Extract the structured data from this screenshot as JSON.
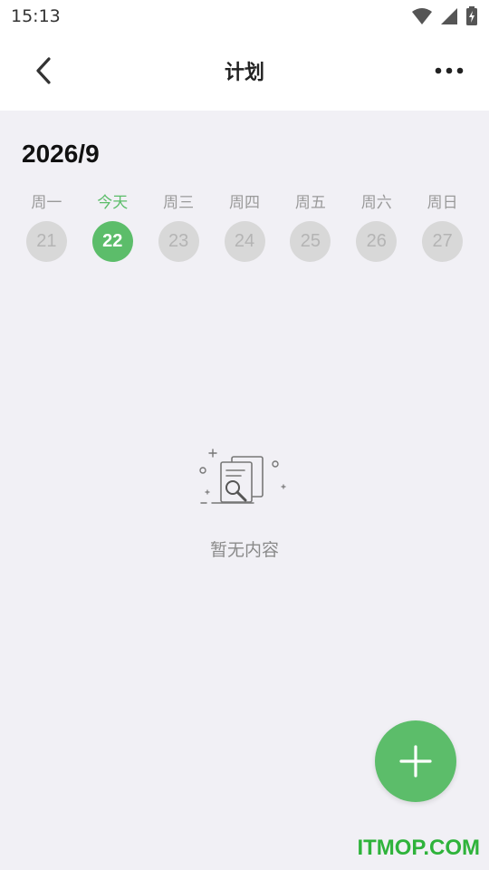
{
  "status_bar": {
    "time": "15:13",
    "icons": [
      "wifi-icon",
      "signal-icon",
      "battery-charging-icon"
    ]
  },
  "header": {
    "title": "计划",
    "back_icon": "back-arrow-icon",
    "more_icon": "more-horizontal-icon"
  },
  "calendar": {
    "month": "2026/9",
    "days": [
      {
        "name": "周一",
        "date": "21",
        "today": false
      },
      {
        "name": "今天",
        "date": "22",
        "today": true
      },
      {
        "name": "周三",
        "date": "23",
        "today": false
      },
      {
        "name": "周四",
        "date": "24",
        "today": false
      },
      {
        "name": "周五",
        "date": "25",
        "today": false
      },
      {
        "name": "周六",
        "date": "26",
        "today": false
      },
      {
        "name": "周日",
        "date": "27",
        "today": false
      }
    ]
  },
  "empty_state": {
    "text": "暂无内容",
    "icon": "empty-document-search-icon"
  },
  "fab": {
    "icon": "plus-icon"
  },
  "watermark": {
    "text": "ITMOP.COM"
  },
  "colors": {
    "accent": "#5cbd6a",
    "background": "#f1f0f5",
    "inactive_circle": "#d8d8d8",
    "watermark": "#2fb33b"
  }
}
